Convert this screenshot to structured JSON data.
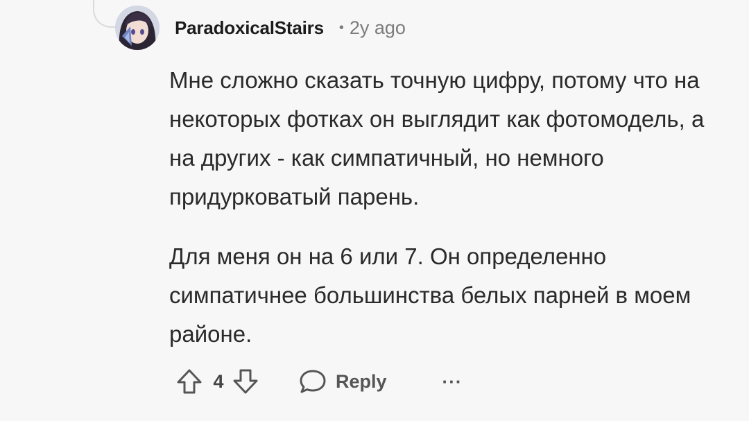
{
  "comment": {
    "author": "ParadoxicalStairs",
    "separator": "•",
    "time": "2y ago",
    "paragraphs": [
      "Мне сложно сказать точную цифру, потому что на некоторых фотках он выглядит как фотомодель, а на других - как симпатичный, но немного придурковатый парень.",
      "Для меня он на 6 или 7. Он определенно симпатичнее большинства белых парней в моем районе."
    ]
  },
  "actions": {
    "vote_count": "4",
    "reply_label": "Reply",
    "more_label": "···"
  },
  "icons": {
    "upvote": "arrow-up-outline-icon",
    "downvote": "arrow-down-outline-icon",
    "reply": "speech-bubble-icon",
    "more": "ellipsis-icon"
  },
  "colors": {
    "background": "#f7f7f8",
    "text": "#2a2a2a",
    "muted": "#7c7c7c",
    "icon": "#555555"
  }
}
